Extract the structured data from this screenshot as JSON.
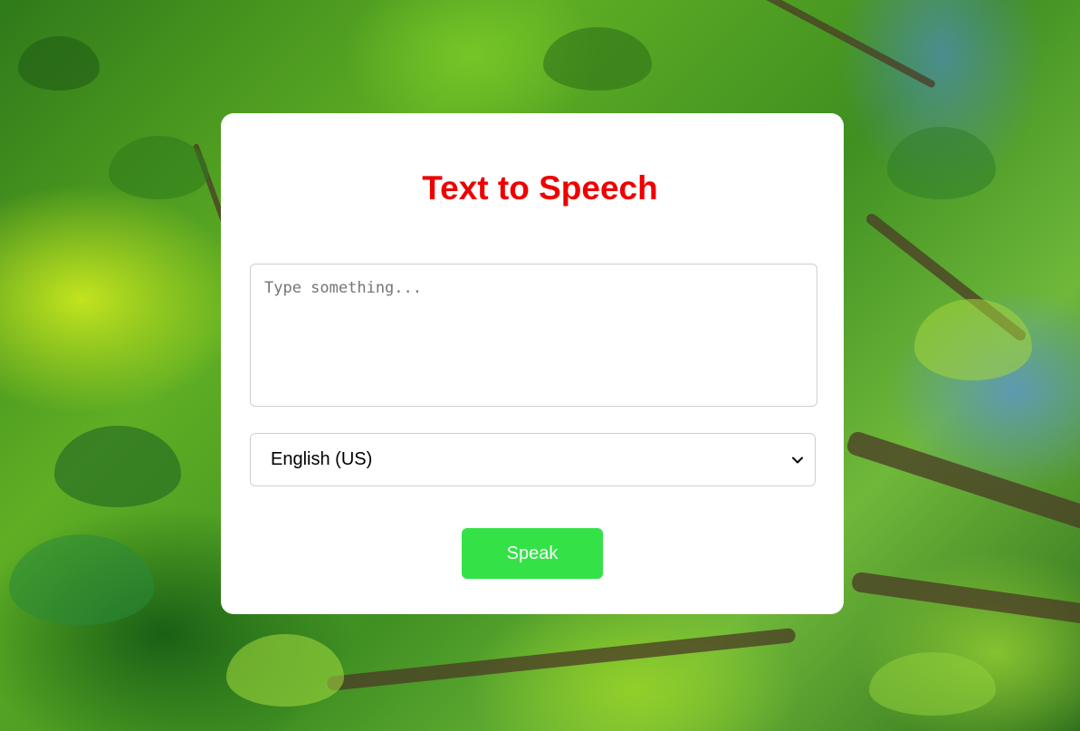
{
  "app": {
    "title": "Text to Speech"
  },
  "input": {
    "value": "",
    "placeholder": "Type something..."
  },
  "language_select": {
    "selected": "English (US)"
  },
  "actions": {
    "speak_label": "Speak"
  },
  "colors": {
    "title": "#ee0000",
    "speak_button": "#34e248",
    "card": "#ffffff"
  },
  "icons": {
    "select_arrow": "chevron-down-icon"
  }
}
